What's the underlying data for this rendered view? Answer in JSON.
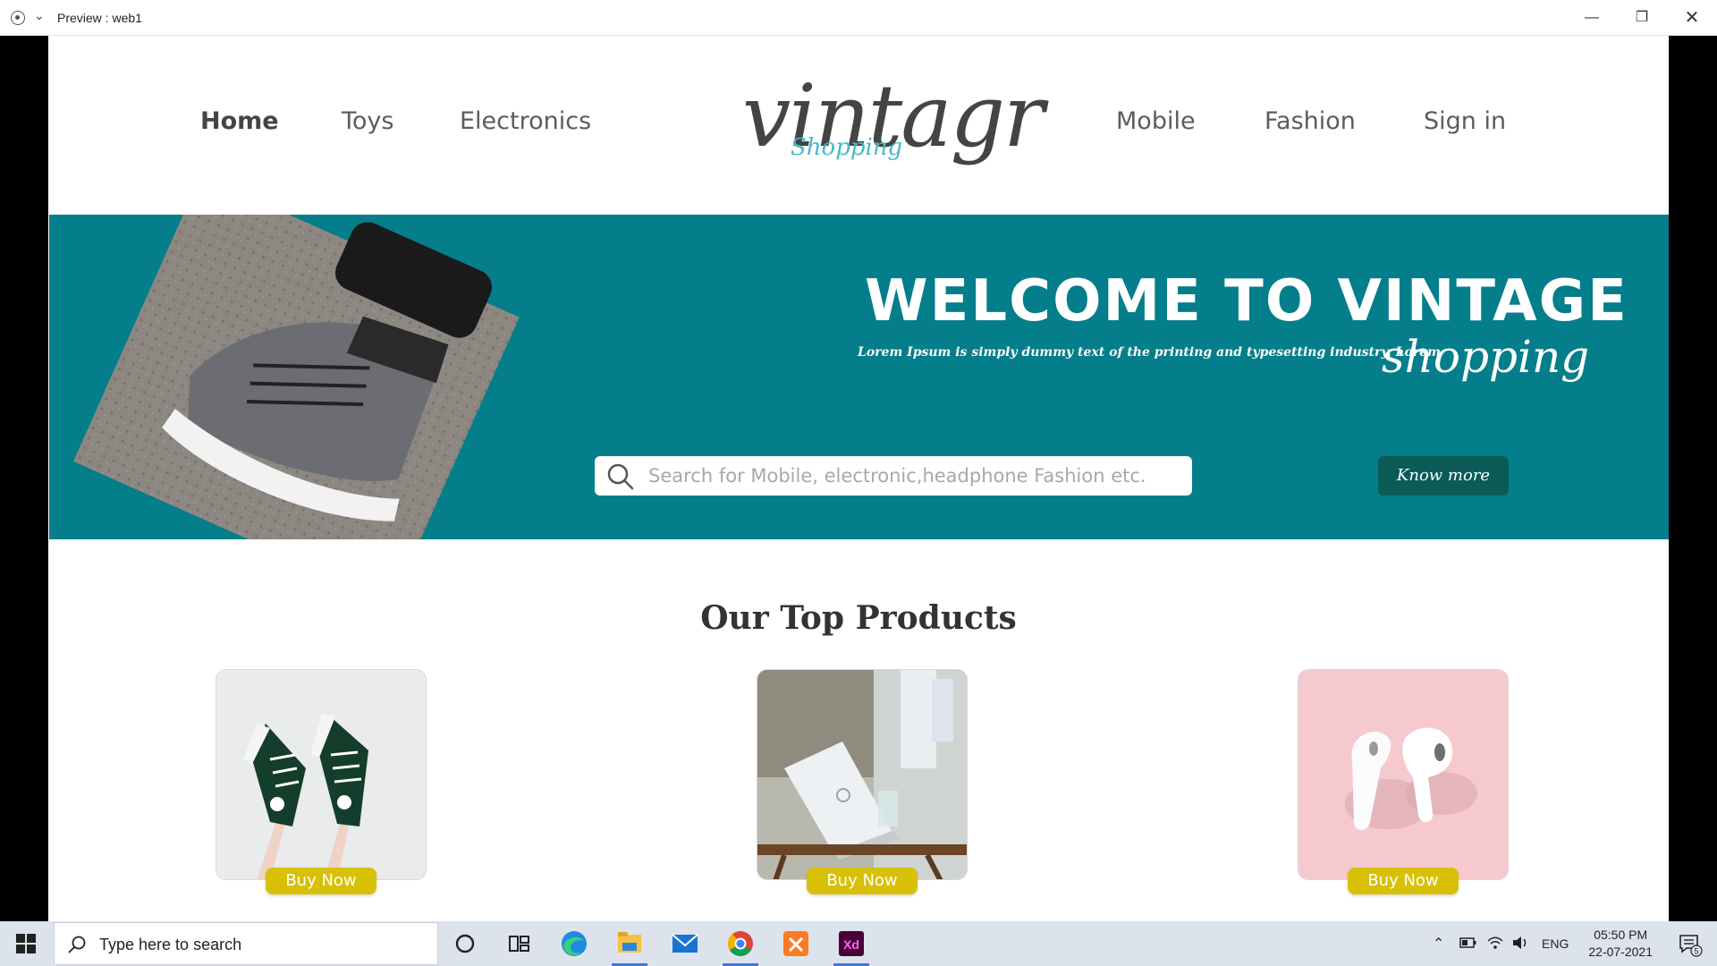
{
  "window": {
    "title": "Preview : web1"
  },
  "nav": {
    "left": [
      "Home",
      "Toys",
      "Electronics"
    ],
    "right": [
      "Mobile",
      "Fashion",
      "Sign in"
    ],
    "active": "Home"
  },
  "logo": {
    "main": "vintagr",
    "sub": "Shopping"
  },
  "hero": {
    "title": "WELCOME TO VINTAGE",
    "subtitle": "Lorem Ipsum is simply dummy text of the printing and typesetting industry. Lorem",
    "script": "shopping",
    "search_placeholder": "Search for Mobile, electronic,headphone Fashion etc.",
    "cta": "Know more"
  },
  "products": {
    "title": "Our Top Products",
    "items": [
      {
        "image": "sneakers-image",
        "button": "Buy Now"
      },
      {
        "image": "laptop-image",
        "button": "Buy Now"
      },
      {
        "image": "earbuds-image",
        "button": "Buy Now"
      }
    ]
  },
  "taskbar": {
    "search_placeholder": "Type here to search",
    "apps": [
      "cortana-icon",
      "task-view-icon",
      "edge-icon",
      "file-explorer-icon",
      "mail-icon",
      "chrome-icon",
      "xampp-icon",
      "adobe-xd-icon"
    ],
    "language": "ENG",
    "time": "05:50 PM",
    "date": "22-07-2021",
    "notifications": "5"
  },
  "colors": {
    "hero_bg": "#057e8b",
    "cta_bg": "#0b5b57",
    "buy_button": "#d8c006",
    "logo_accent": "#47b9c9"
  }
}
